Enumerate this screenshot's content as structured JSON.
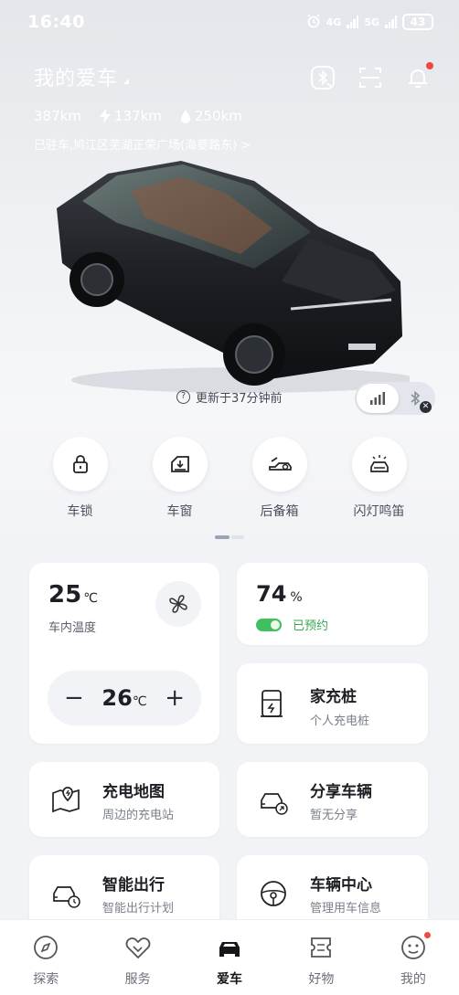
{
  "status_bar": {
    "time": "16:40",
    "network1": "4G",
    "network2": "5G",
    "battery": "43"
  },
  "header": {
    "title": "我的爱车",
    "range_total": "387km",
    "range_electric": "137km",
    "range_fuel": "250km",
    "location": "已驻车,鸠江区芜湖正荣广场(海夔路东) >",
    "icons": [
      "bluetooth-off-icon",
      "scan-icon",
      "bell-icon"
    ]
  },
  "car_status": {
    "updated": "更新于37分钟前"
  },
  "quick_actions": [
    {
      "label": "车锁",
      "icon": "lock-icon"
    },
    {
      "label": "车窗",
      "icon": "window-icon"
    },
    {
      "label": "后备箱",
      "icon": "trunk-icon"
    },
    {
      "label": "闪灯鸣笛",
      "icon": "horn-light-icon"
    }
  ],
  "climate": {
    "interior_temp": "25",
    "unit": "℃",
    "label": "车内温度",
    "set_temp": "26",
    "minus": "−",
    "plus": "+"
  },
  "battery": {
    "soc": "74",
    "unit": "%",
    "status": "已预约"
  },
  "services": {
    "home_charger": {
      "title": "家充桩",
      "subtitle": "个人充电桩"
    },
    "charge_map": {
      "title": "充电地图",
      "subtitle": "周边的充电站"
    },
    "share": {
      "title": "分享车辆",
      "subtitle": "暂无分享"
    },
    "smart_trip": {
      "title": "智能出行",
      "subtitle": "智能出行计划"
    },
    "vehicle_center": {
      "title": "车辆中心",
      "subtitle": "管理用车信息"
    }
  },
  "tabs": [
    {
      "label": "探索",
      "icon": "compass-icon"
    },
    {
      "label": "服务",
      "icon": "handshake-icon"
    },
    {
      "label": "爱车",
      "icon": "car-icon"
    },
    {
      "label": "好物",
      "icon": "ticket-icon"
    },
    {
      "label": "我的",
      "icon": "smile-icon"
    }
  ],
  "colors": {
    "accent_green": "#3fbf5d",
    "notification_red": "#ef4a3c",
    "page_bg": "#f2f3f6"
  }
}
